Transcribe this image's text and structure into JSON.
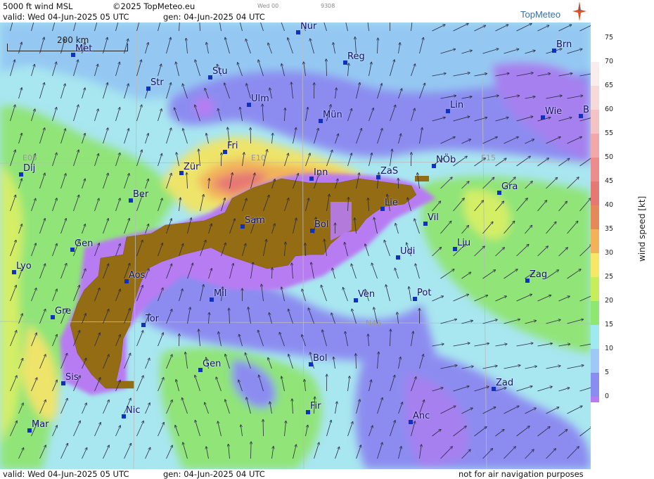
{
  "header": {
    "product": "5000 ft wind MSL",
    "copyright": "©2025 TopMeteo.eu",
    "valid": "valid:  Wed  04-Jun-2025  05 UTC",
    "gen": "gen: 04-Jun-2025 04 UTC",
    "small_day": "Wed 00",
    "small_code": "9308",
    "logo": "TopMeteo"
  },
  "footer": {
    "valid": "valid:  Wed  04-Jun-2025  05 UTC",
    "gen": "gen: 04-Jun-2025 04 UTC",
    "disclaimer": "not for air navigation purposes"
  },
  "map": {
    "scale_label": "200 km",
    "grid_labels": [
      "E05",
      "E10",
      "E15",
      "N45"
    ],
    "cities": [
      {
        "name": "Nür"
      },
      {
        "name": "Reg"
      },
      {
        "name": "Met"
      },
      {
        "name": "Str"
      },
      {
        "name": "Stu"
      },
      {
        "name": "Ulm"
      },
      {
        "name": "Mün"
      },
      {
        "name": "Lin"
      },
      {
        "name": "Wie"
      },
      {
        "name": "Brn"
      },
      {
        "name": "B"
      },
      {
        "name": "Fri"
      },
      {
        "name": "Zür"
      },
      {
        "name": "Inn"
      },
      {
        "name": "ZaS"
      },
      {
        "name": "NÖb"
      },
      {
        "name": "Dij"
      },
      {
        "name": "Ber"
      },
      {
        "name": "Gra"
      },
      {
        "name": "Lie"
      },
      {
        "name": "Sam"
      },
      {
        "name": "Bol"
      },
      {
        "name": "Vil"
      },
      {
        "name": "Gen"
      },
      {
        "name": "Lju"
      },
      {
        "name": "Udi"
      },
      {
        "name": "Lyo"
      },
      {
        "name": "Aos"
      },
      {
        "name": "Zag"
      },
      {
        "name": "Mil"
      },
      {
        "name": "Ven"
      },
      {
        "name": "Pot"
      },
      {
        "name": "Gre"
      },
      {
        "name": "Tor"
      },
      {
        "name": "Gen"
      },
      {
        "name": "Bol"
      },
      {
        "name": "Sis"
      },
      {
        "name": "Zad"
      },
      {
        "name": "Nic"
      },
      {
        "name": "Fir"
      },
      {
        "name": "Anc"
      },
      {
        "name": "Mar"
      }
    ]
  },
  "legend": {
    "title": "wind speed [kt]",
    "ticks": [
      "75",
      "70",
      "65",
      "60",
      "55",
      "50",
      "45",
      "40",
      "35",
      "30",
      "25",
      "20",
      "15",
      "10",
      "5",
      "0"
    ],
    "colors": [
      "#ffffff",
      "#f8ecec",
      "#f6dada",
      "#f4c4c4",
      "#f2a8a8",
      "#ec8c8c",
      "#e67874",
      "#e4895a",
      "#f2b25a",
      "#f6e866",
      "#c6ee5a",
      "#8ee870",
      "#9eeaf0",
      "#9ec8f6",
      "#8a8cf0",
      "#b87cf2"
    ]
  }
}
